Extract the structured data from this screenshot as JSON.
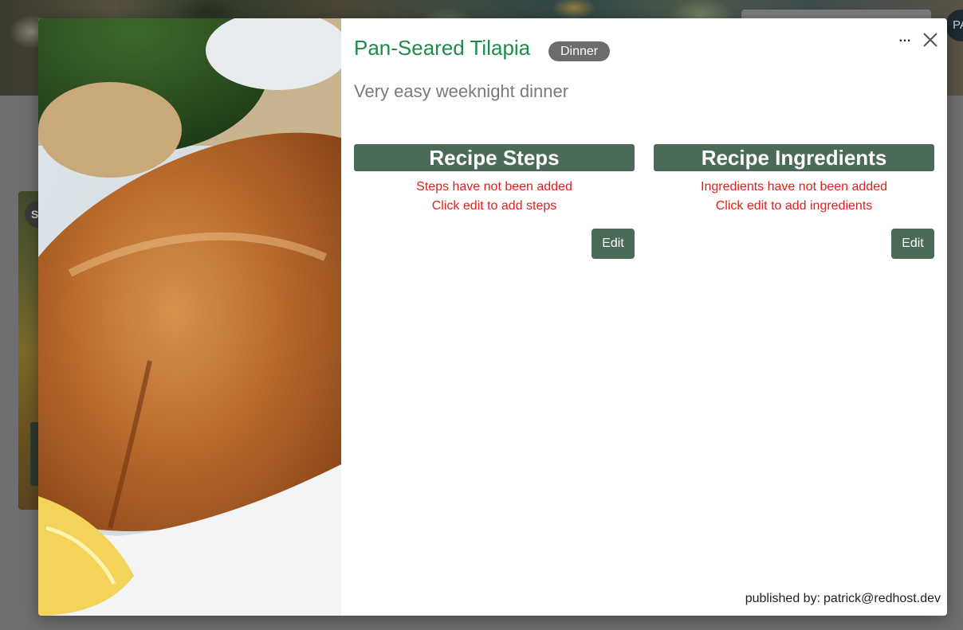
{
  "background": {
    "avatar_initials": "PA",
    "card_badge_initial": "S"
  },
  "modal": {
    "recipe_title": "Pan-Seared Tilapia",
    "category": "Dinner",
    "description": "Very easy weeknight dinner",
    "more_icon": "…",
    "close_icon": "close-icon",
    "steps": {
      "header": "Recipe Steps",
      "empty_line1": "Steps have not been added",
      "empty_line2": "Click edit to add steps",
      "edit_label": "Edit"
    },
    "ingredients": {
      "header": "Recipe Ingredients",
      "empty_line1": "Ingredients have not been added",
      "empty_line2": "Click edit to add ingredients",
      "edit_label": "Edit"
    },
    "published_label": "published by:",
    "published_by": "patrick@redhost.dev"
  },
  "colors": {
    "title_green": "#1f8a4c",
    "section_green": "#4c6a58",
    "error_red": "#e0201c",
    "badge_gray": "#6c6c6c"
  }
}
